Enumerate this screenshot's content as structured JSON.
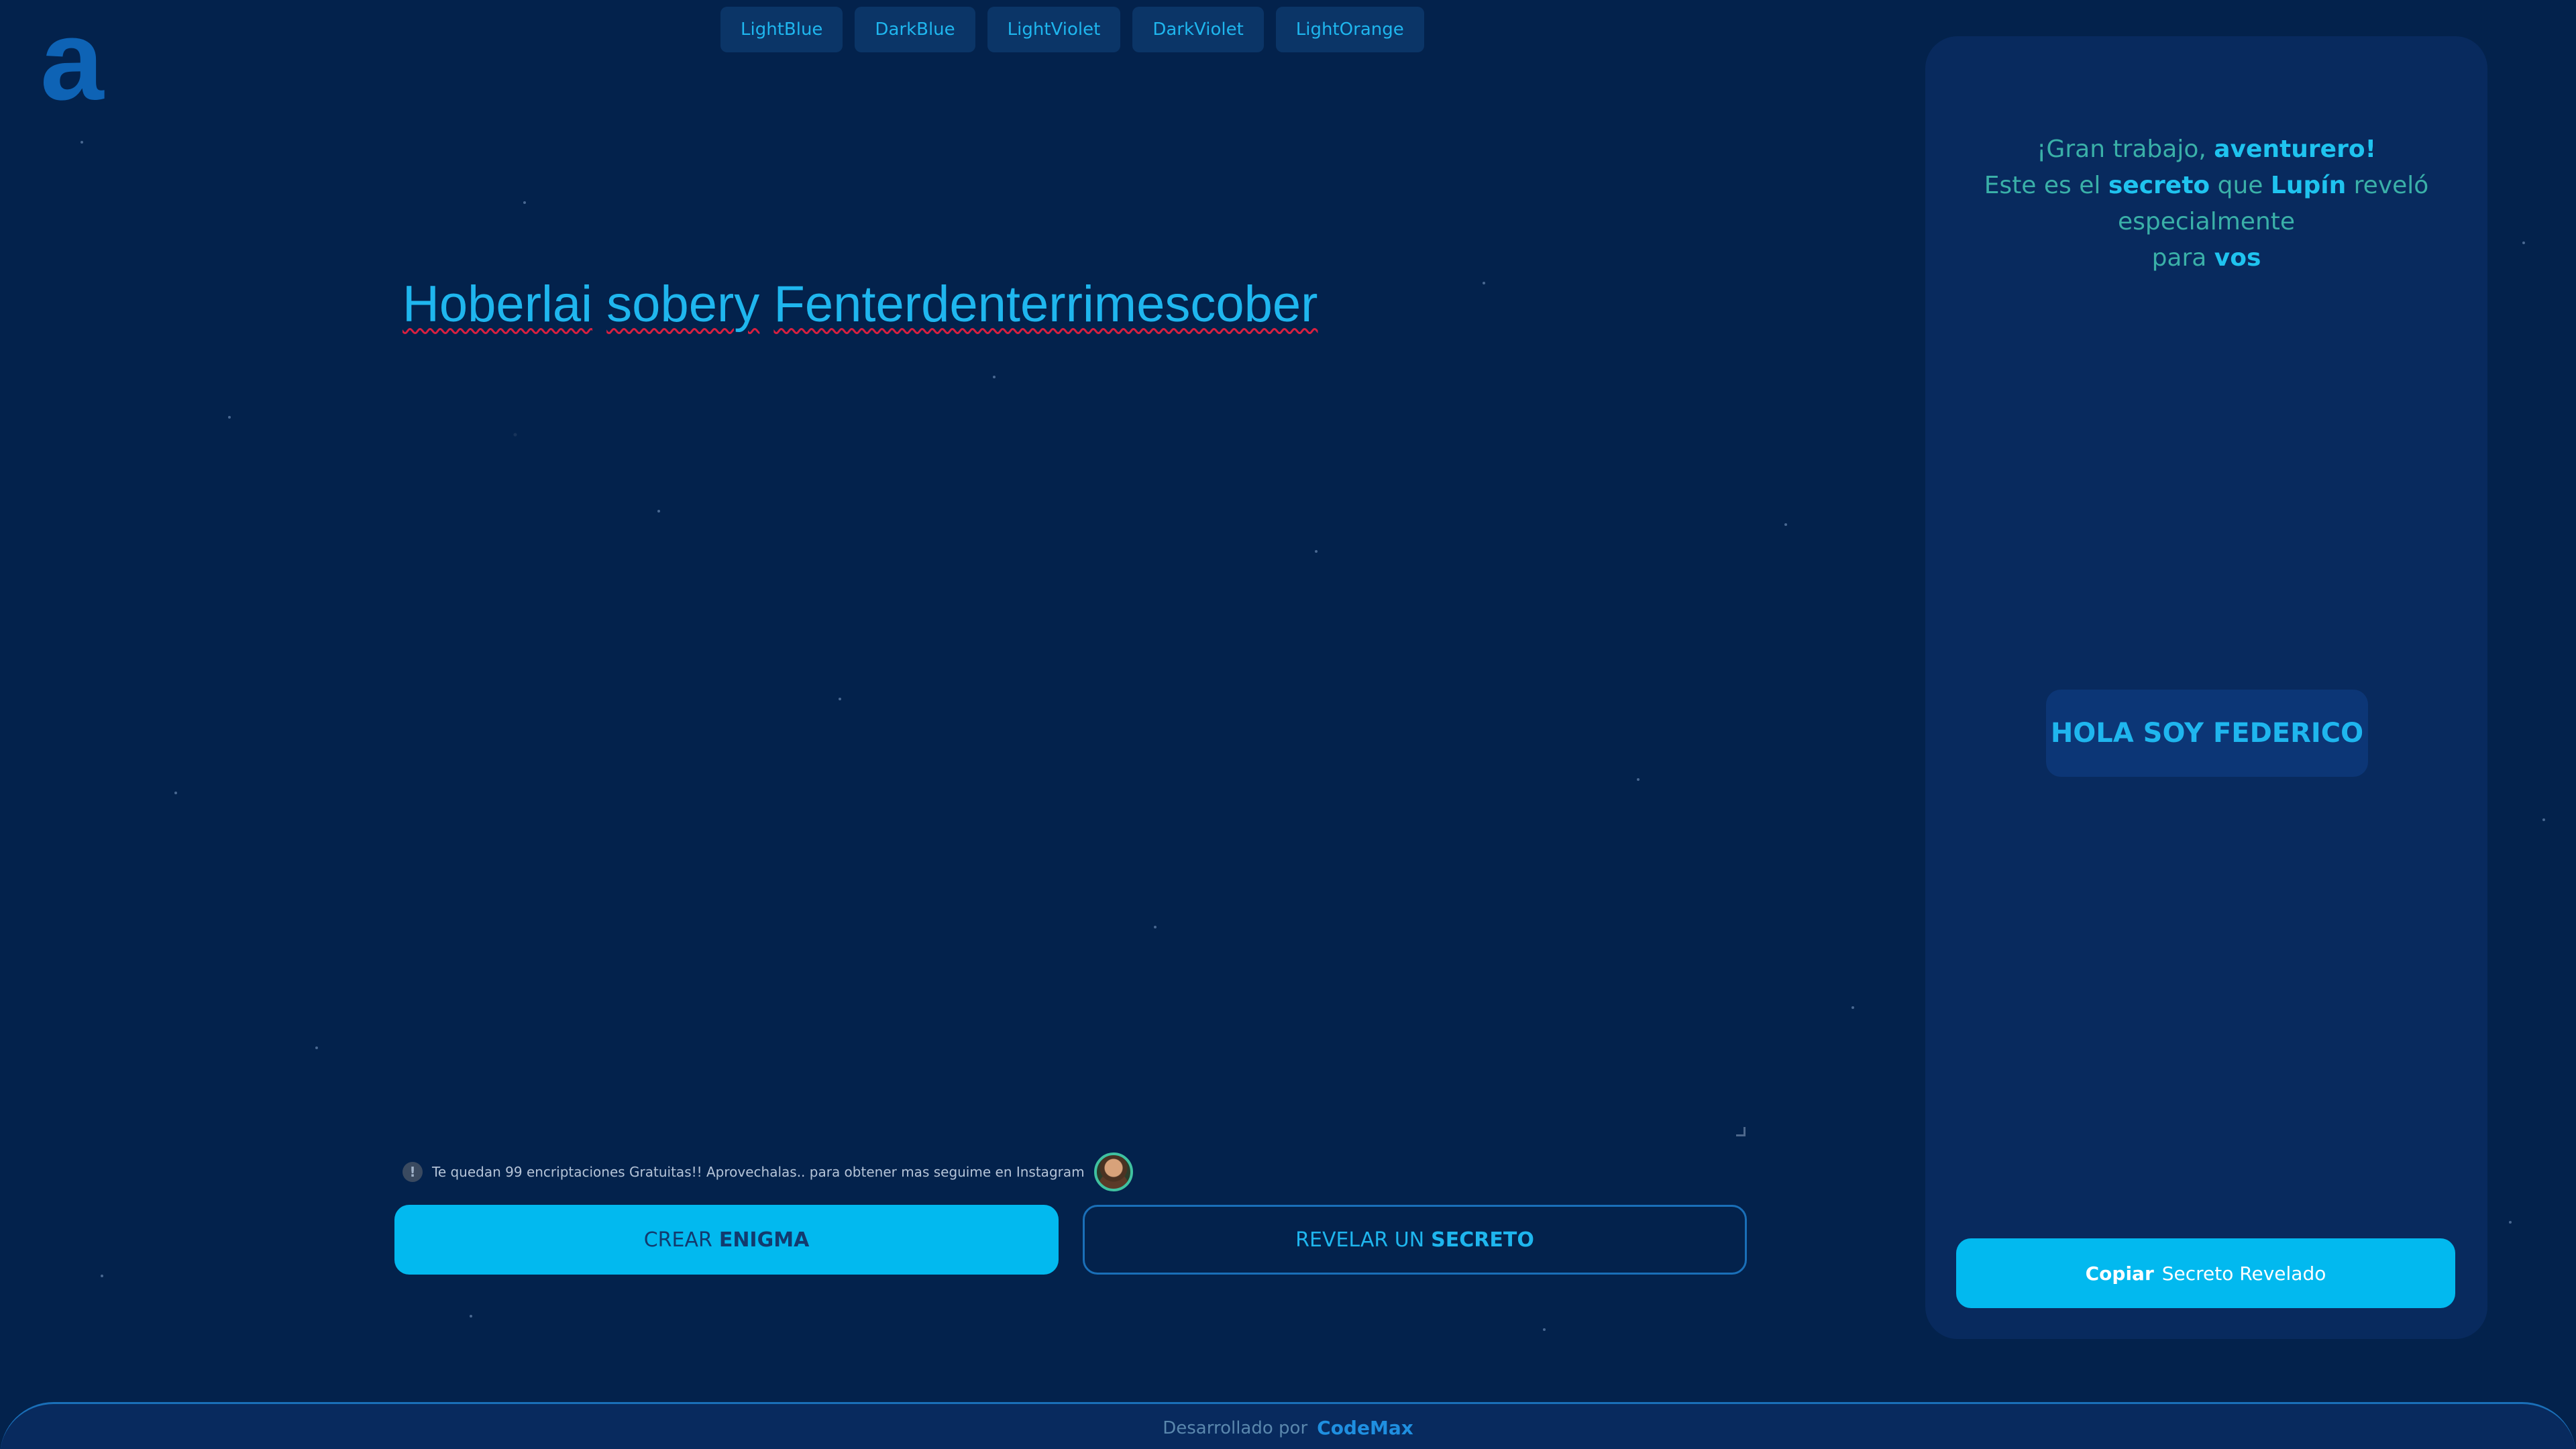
{
  "logo": {
    "glyph": "a"
  },
  "themes": [
    {
      "label": "LightBlue"
    },
    {
      "label": "DarkBlue"
    },
    {
      "label": "LightViolet"
    },
    {
      "label": "DarkViolet"
    },
    {
      "label": "LightOrange"
    }
  ],
  "editor": {
    "words": [
      "Hoberlai",
      "sobery",
      "Fenterdenterrimescober"
    ]
  },
  "notice": {
    "icon": "info-icon",
    "text": "Te quedan 99 encriptaciones Gratuitas!! Aprovechalas.. para obtener mas seguime en Instagram"
  },
  "actions": {
    "create_prefix": "CREAR",
    "create_strong": "ENIGMA",
    "reveal_prefix": "REVELAR UN",
    "reveal_strong": "SECRETO"
  },
  "panel": {
    "line1_a": "¡Gran trabajo,",
    "line1_b": "aventurero!",
    "line2_a": "Este es el",
    "line2_b": "secreto",
    "line2_c": "que",
    "line2_d": "Lupín",
    "line2_e": "reveló",
    "line3": "especialmente",
    "line4_a": "para",
    "line4_b": "vos",
    "secret": "HOLA SOY FEDERICO",
    "copy_strong": "Copiar",
    "copy_rest": "Secreto Revelado"
  },
  "footer": {
    "label": "Desarrollado por",
    "brand": "CodeMax"
  },
  "colors": {
    "background": "#03224c",
    "accent": "#02b9ef",
    "panel": "#082a5e"
  }
}
